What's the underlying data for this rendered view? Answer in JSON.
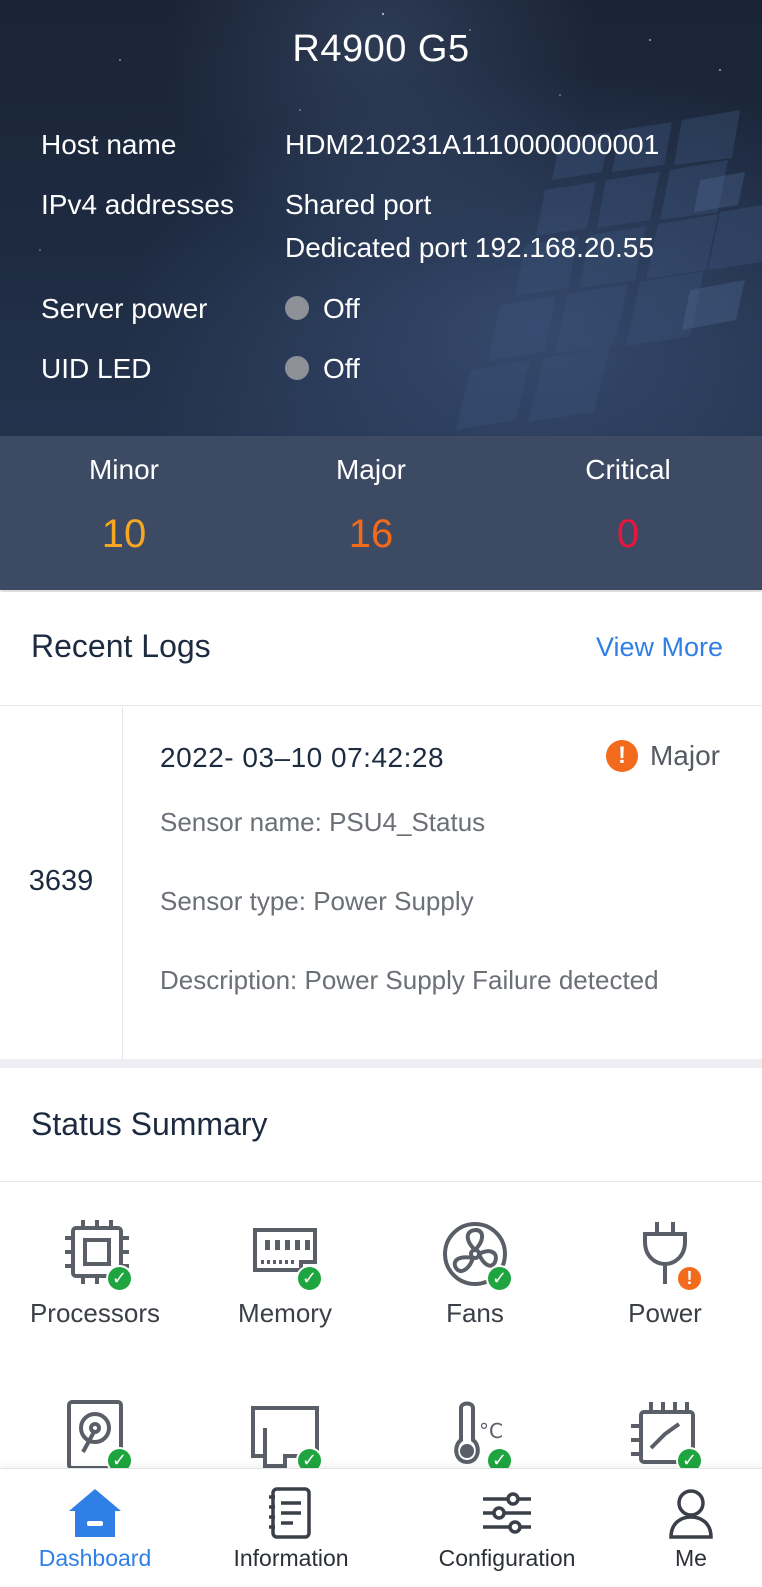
{
  "header": {
    "title": "R4900 G5",
    "host_label": "Host name",
    "host_value": "HDM210231A1110000000001",
    "ipv4_label": "IPv4 addresses",
    "ipv4_shared": "Shared port",
    "ipv4_dedicated": "Dedicated port 192.168.20.55",
    "power_label": "Server power",
    "power_value": "Off",
    "uid_label": "UID LED",
    "uid_value": "Off"
  },
  "alarms": {
    "minor_label": "Minor",
    "minor_count": "10",
    "major_label": "Major",
    "major_count": "16",
    "critical_label": "Critical",
    "critical_count": "0",
    "colors": {
      "minor": "#f5a623",
      "major": "#f26a1b",
      "critical": "#e8153f"
    }
  },
  "recent_logs": {
    "title": "Recent Logs",
    "view_more": "View More",
    "entry": {
      "id": "3639",
      "timestamp": "2022- 03–10 07:42:28",
      "severity": "Major",
      "sensor_name": "Sensor name: PSU4_Status",
      "sensor_type": "Sensor type: Power Supply",
      "description": "Description: Power Supply Failure detected"
    }
  },
  "status_summary": {
    "title": "Status Summary",
    "items": [
      {
        "label": "Processors",
        "icon": "processor-icon",
        "status": "ok"
      },
      {
        "label": "Memory",
        "icon": "memory-icon",
        "status": "ok"
      },
      {
        "label": "Fans",
        "icon": "fan-icon",
        "status": "ok"
      },
      {
        "label": "Power",
        "icon": "power-plug-icon",
        "status": "warning"
      },
      {
        "label": "",
        "icon": "storage-disk-icon",
        "status": "ok"
      },
      {
        "label": "",
        "icon": "pcie-card-icon",
        "status": "ok"
      },
      {
        "label": "",
        "icon": "temperature-icon",
        "status": "ok"
      },
      {
        "label": "",
        "icon": "mainboard-icon",
        "status": "ok"
      }
    ]
  },
  "tabbar": {
    "tabs": [
      {
        "label": "Dashboard",
        "icon": "home-icon",
        "active": true
      },
      {
        "label": "Information",
        "icon": "document-list-icon",
        "active": false
      },
      {
        "label": "Configuration",
        "icon": "sliders-icon",
        "active": false
      },
      {
        "label": "Me",
        "icon": "person-icon",
        "active": false
      }
    ],
    "accent": "#2f7fe6"
  }
}
